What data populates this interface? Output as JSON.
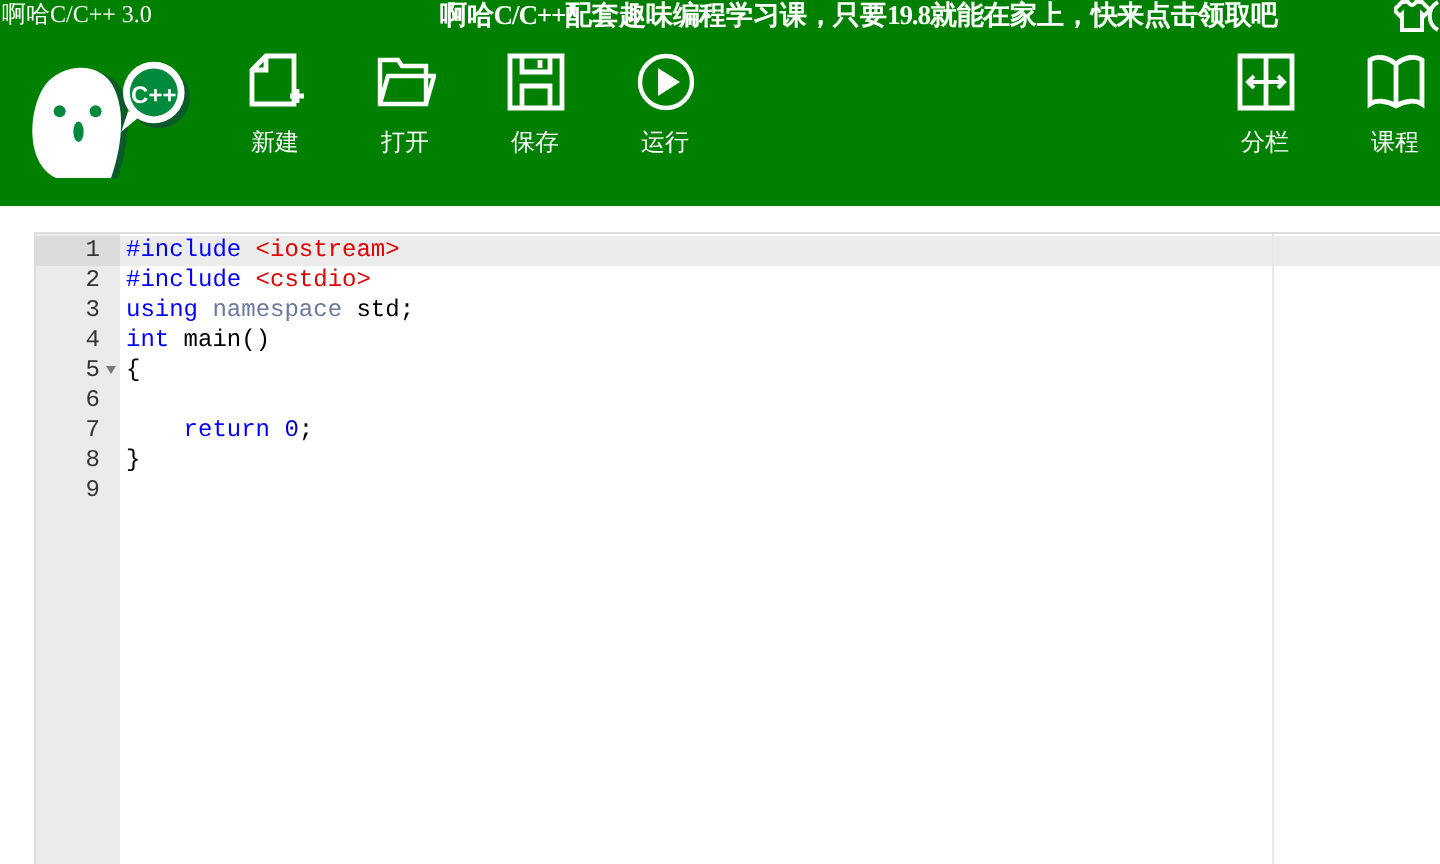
{
  "window": {
    "title": "啊哈C/C++ 3.0"
  },
  "banner": "啊哈C/C++配套趣味编程学习课，只要19.8就能在家上，快来点击领取吧",
  "logo": {
    "badge": "C++"
  },
  "toolbar": {
    "left": [
      {
        "label": "新建",
        "kind": "new"
      },
      {
        "label": "打开",
        "kind": "open"
      },
      {
        "label": "保存",
        "kind": "save"
      },
      {
        "label": "运行",
        "kind": "run"
      }
    ],
    "right": [
      {
        "label": "分栏",
        "kind": "split"
      },
      {
        "label": "课程",
        "kind": "book"
      }
    ]
  },
  "editor": {
    "lines": [
      {
        "number": "1",
        "active": true,
        "fold": false,
        "tokens": [
          {
            "text": "#include",
            "kind": "keyword"
          },
          {
            "text": " <iostream>",
            "kind": "string"
          }
        ]
      },
      {
        "number": "2",
        "active": false,
        "fold": false,
        "tokens": [
          {
            "text": "#include",
            "kind": "keyword"
          },
          {
            "text": " <cstdio>",
            "kind": "string"
          }
        ]
      },
      {
        "number": "3",
        "active": false,
        "fold": false,
        "tokens": [
          {
            "text": "using",
            "kind": "keyword"
          },
          {
            "text": " namespace",
            "kind": "muted"
          },
          {
            "text": " std;",
            "kind": "plain"
          }
        ]
      },
      {
        "number": "4",
        "active": false,
        "fold": false,
        "tokens": [
          {
            "text": "int",
            "kind": "keyword"
          },
          {
            "text": " main()",
            "kind": "plain"
          }
        ]
      },
      {
        "number": "5",
        "active": false,
        "fold": true,
        "tokens": [
          {
            "text": "{",
            "kind": "plain"
          }
        ]
      },
      {
        "number": "6",
        "active": false,
        "fold": false
      },
      {
        "number": "7",
        "active": false,
        "fold": false,
        "tokens": [
          {
            "text": "    return",
            "kind": "keyword"
          },
          {
            "text": " 0",
            "kind": "number"
          },
          {
            "text": ";",
            "kind": "plain"
          }
        ]
      },
      {
        "number": "8",
        "active": false,
        "fold": false,
        "tokens": [
          {
            "text": "}",
            "kind": "plain"
          }
        ]
      },
      {
        "number": "9",
        "active": false,
        "fold": false
      }
    ]
  }
}
